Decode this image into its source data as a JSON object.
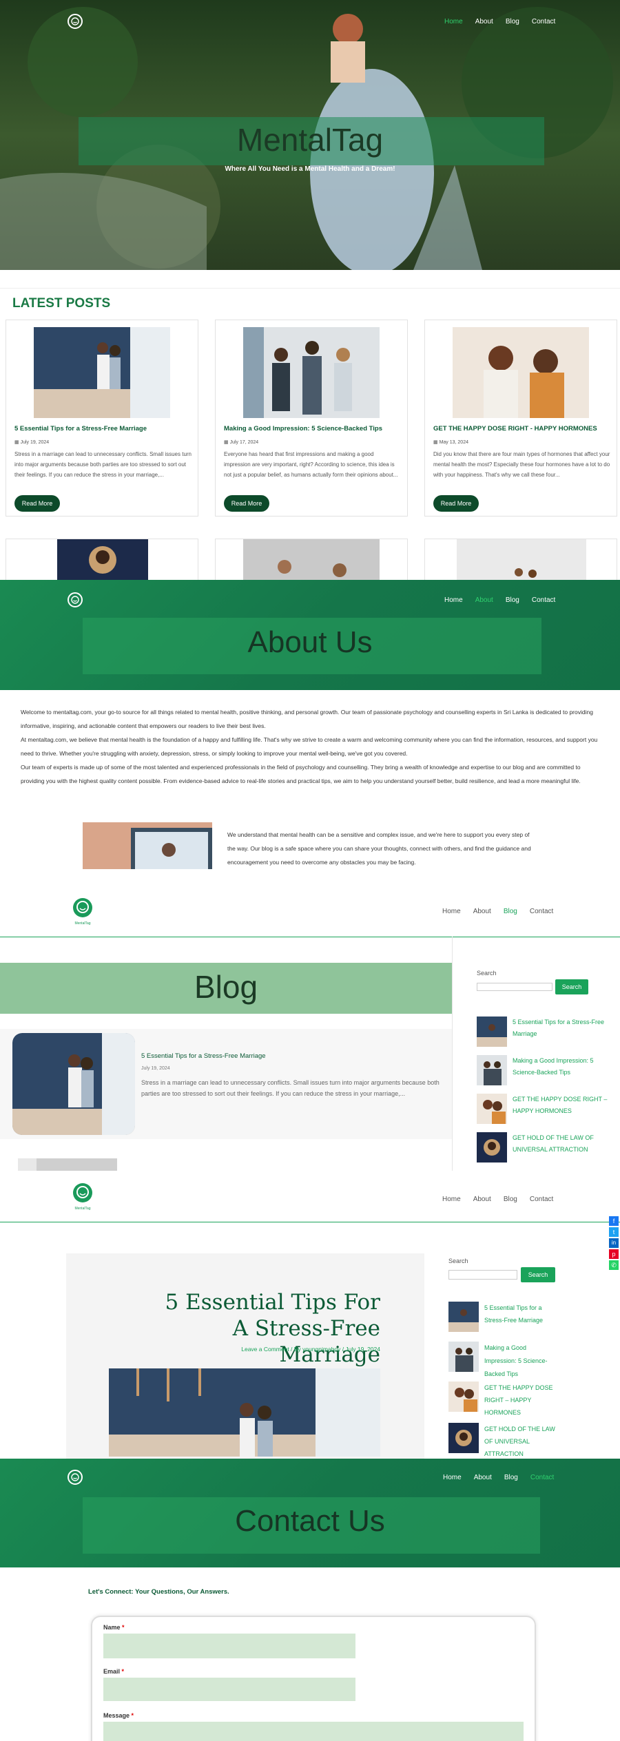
{
  "hero": {
    "nav": [
      "Home",
      "About",
      "Blog",
      "Contact"
    ],
    "title": "MentalTag",
    "tagline": "Where All You Need is a Mental Health and a Dream!"
  },
  "latest": {
    "heading": "LATEST POSTS",
    "read_more": "Read More",
    "posts": [
      {
        "title": "5 Essential Tips for a Stress-Free Marriage",
        "date": "July 19, 2024",
        "excerpt": "Stress in a marriage can lead to unnecessary conflicts. Small issues turn into major arguments because both parties are too stressed to sort out their feelings. If you can reduce the stress in your marriage,..."
      },
      {
        "title": "Making a Good Impression: 5 Science-Backed Tips",
        "date": "July 17, 2024",
        "excerpt": "Everyone has heard that first impressions and making a good impression are very important, right? According to science, this idea is not just a popular belief, as humans actually form their opinions about..."
      },
      {
        "title": "GET THE HAPPY DOSE RIGHT - HAPPY HORMONES",
        "date": "May 13, 2024",
        "excerpt": "Did you know that there are four main types of hormones that affect your mental health the most? Especially these four hormones have a lot to do with your happiness. That's why we call these four..."
      }
    ]
  },
  "about": {
    "nav": [
      "Home",
      "About",
      "Blog",
      "Contact"
    ],
    "title": "About Us",
    "para1": "Welcome to mentaltag.com, your go-to source for all things related to mental health, positive thinking, and personal growth. Our team of passionate psychology and counselling experts in Sri Lanka is dedicated to providing informative, inspiring, and actionable content that empowers our readers to live their best lives.",
    "para2": "At mentaltag.com, we believe that mental health is the foundation of a happy and fulfilling life. That's why we strive to create a warm and welcoming community where you can find the information, resources, and support you need to thrive. Whether you're struggling with anxiety, depression, stress, or simply looking to improve your mental well-being, we've got you covered.",
    "para3": "Our team of experts is made up of some of the most talented and experienced professionals in the field of psychology and counselling. They bring a wealth of knowledge and expertise to our blog and are committed to providing you with the highest quality content possible. From evidence-based advice to real-life stories and practical tips, we aim to help you understand yourself better, build resilience, and lead a more meaningful life.",
    "para4": "We understand that mental health can be a sensitive and complex issue, and we're here to support you every step of the way. Our blog is a safe space where you can share your thoughts, connect with others, and find the guidance and encouragement you need to overcome any obstacles you may be facing."
  },
  "blog": {
    "nav": [
      "Home",
      "About",
      "Blog",
      "Contact"
    ],
    "logo_text": "MentalTag",
    "title": "Blog",
    "post": {
      "title": "5 Essential Tips for a Stress-Free Marriage",
      "date": "July 19, 2024",
      "excerpt": "Stress in a marriage can lead to unnecessary conflicts. Small issues turn into major arguments because both parties are too stressed to sort out their feelings. If you can reduce the stress in your marriage,..."
    },
    "sidebar": {
      "search_label": "Search",
      "search_button": "Search",
      "posts": [
        "5 Essential Tips for a Stress-Free Marriage",
        "Making a Good Impression: 5 Science-Backed Tips",
        "GET THE HAPPY DOSE RIGHT – HAPPY HORMONES",
        "GET HOLD OF THE LAW OF UNIVERSAL ATTRACTION"
      ]
    }
  },
  "single": {
    "nav": [
      "Home",
      "About",
      "Blog",
      "Contact"
    ],
    "logo_text": "MentalTag",
    "title": "5 Essential Tips For A Stress-Free Marriage",
    "meta": "Leave a Comment / By youngnimaboy / July 19, 2024",
    "sidebar": {
      "search_label": "Search",
      "search_button": "Search",
      "posts": [
        "5 Essential Tips for a Stress-Free Marriage",
        "Making a Good Impression: 5 Science-Backed Tips",
        "GET THE HAPPY DOSE RIGHT – HAPPY HORMONES",
        "GET HOLD OF THE LAW OF UNIVERSAL ATTRACTION"
      ]
    },
    "share_icons": [
      "facebook-icon",
      "twitter-icon",
      "linkedin-icon",
      "pinterest-icon",
      "whatsapp-icon"
    ]
  },
  "contact": {
    "nav": [
      "Home",
      "About",
      "Blog",
      "Contact"
    ],
    "title": "Contact Us",
    "intro": "Let's Connect: Your Questions, Our Answers.",
    "name_label": "Name",
    "email_label": "Email",
    "message_label": "Message",
    "required_mark": "*"
  },
  "colors": {
    "brand_green": "#0b5a35",
    "accent_green": "#1aa35a",
    "hero_band": "#1f8a55"
  }
}
